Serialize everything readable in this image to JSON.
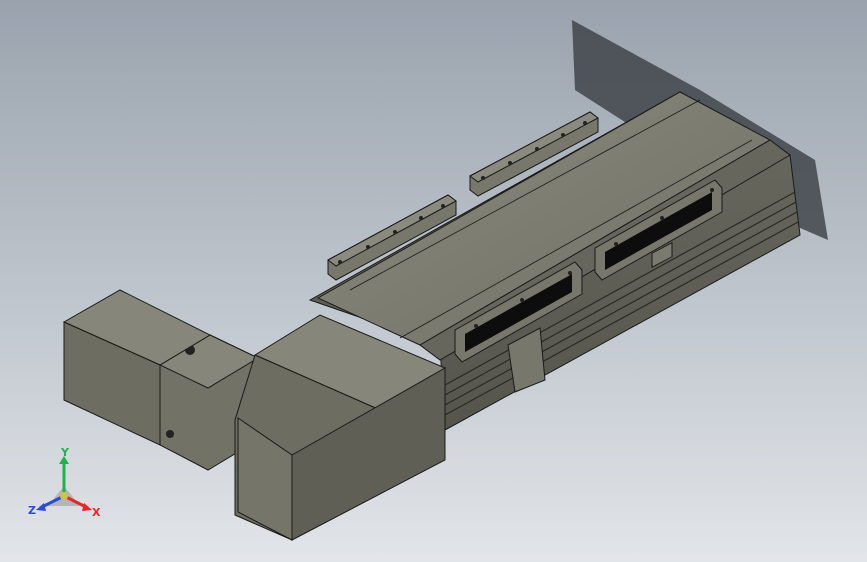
{
  "viewport": {
    "background_top": "#9aa3ad",
    "background_bottom": "#e2e5e9",
    "model_color": "#7d7d72",
    "edge_color": "#1a1a1a"
  },
  "model": {
    "description_icon": "linear-stage-actuator-model",
    "components": [
      "rail-body",
      "top-cover",
      "carriage-front",
      "carriage-rear",
      "mounting-bracket-front",
      "mounting-bracket-rear",
      "coupling-housing",
      "motor-block",
      "motor-gearbox"
    ]
  },
  "triad": {
    "x_label": "X",
    "y_label": "Y",
    "z_label": "Z",
    "x_color": "#e8262b",
    "y_color": "#23b14d",
    "z_color": "#2d4ad8"
  }
}
